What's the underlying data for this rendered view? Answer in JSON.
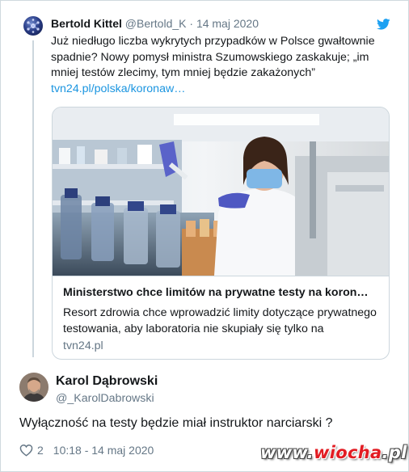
{
  "quoted_tweet": {
    "author_name": "Bertold Kittel",
    "author_handle": "@Bertold_K",
    "separator": "·",
    "date": "14 maj 2020",
    "text": "Już niedługo liczba wykrytych przypadków w Polsce gwałtownie spadnie? Nowy pomysł ministra Szumowskiego zaskakuje; „im mniej testów zlecimy, tym mniej będzie zakażonych”",
    "link_text": "tvn24.pl/polska/koronaw…",
    "card": {
      "title": "Ministerstwo chce limitów na prywatne testy na koron…",
      "description": "Resort zdrowia chce wprowadzić limity dotyczące prywatnego testowania, aby laboratoria nie skupiały się tylko na",
      "domain": "tvn24.pl"
    }
  },
  "reply": {
    "author_name": "Karol Dąbrowski",
    "author_handle": "@_KarolDabrowski",
    "text": "Wyłączność na testy będzie miał instruktor narciarski ?",
    "like_count": "2",
    "timestamp": "10:18 - 14 maj 2020"
  },
  "watermark": {
    "prefix": "www.",
    "accent": "wiocha",
    "suffix": ".pl"
  },
  "icons": {
    "brand": "twitter-bird-icon",
    "like": "heart-icon"
  },
  "colors": {
    "link": "#1b95e0",
    "secondary_text": "#657786",
    "twitter_blue": "#1da1f2",
    "watermark_accent": "#e21c23"
  }
}
